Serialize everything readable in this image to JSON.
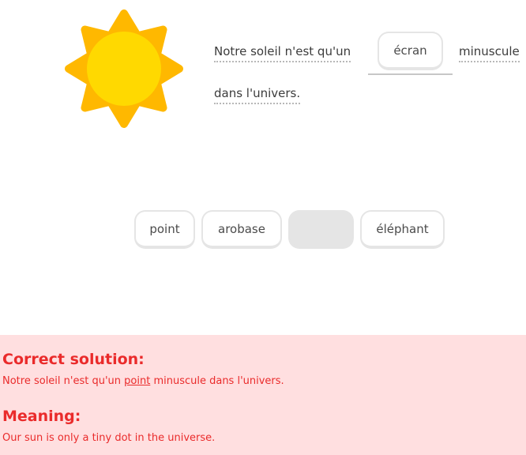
{
  "illustration": {
    "icon": "sun-icon",
    "colors": {
      "rays": "#FFB800",
      "core": "#FFD900"
    }
  },
  "sentence": {
    "part1": "Notre soleil n'est qu'un",
    "selected_word": "écran",
    "part2": "minuscule",
    "part3": "dans l'univers."
  },
  "word_bank": {
    "tiles": [
      {
        "label": "point",
        "state": "available"
      },
      {
        "label": "arobase",
        "state": "available"
      },
      {
        "label": "",
        "state": "used"
      },
      {
        "label": "éléphant",
        "state": "available"
      }
    ]
  },
  "feedback": {
    "status": "incorrect",
    "colors": {
      "background": "#FFDFE0",
      "text": "#EA2B2B"
    },
    "solution_heading": "Correct solution:",
    "solution_before": "Notre soleil n'est qu'un ",
    "solution_word": "point",
    "solution_after": " minuscule dans l'univers.",
    "meaning_heading": "Meaning:",
    "meaning_text": "Our sun is only a tiny dot in the universe."
  }
}
